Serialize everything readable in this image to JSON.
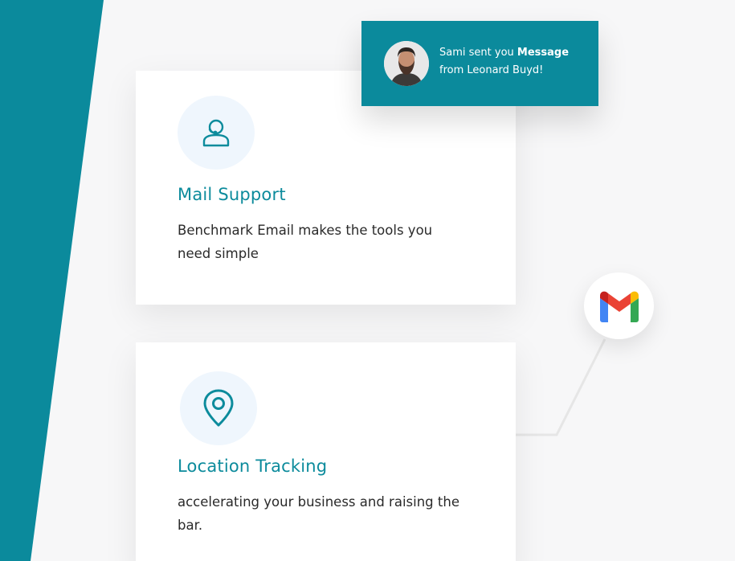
{
  "notification": {
    "sender": "Sami",
    "text_before": "sent you",
    "highlight": "Message",
    "text_after": "from Leonard Buyd!"
  },
  "cards": [
    {
      "title": "Mail Support",
      "description": "Benchmark Email makes the tools you need simple",
      "icon": "support-agent-icon"
    },
    {
      "title": "Location Tracking",
      "description": "accelerating your business and raising the bar.",
      "icon": "location-pin-icon"
    }
  ],
  "integration": {
    "icon": "gmail-icon"
  },
  "colors": {
    "accent": "#0b8a9c",
    "card_title": "#0c8b9c",
    "icon_bg": "#eff6fd",
    "page_bg": "#f7f7f8",
    "text": "#2a2a2a"
  }
}
